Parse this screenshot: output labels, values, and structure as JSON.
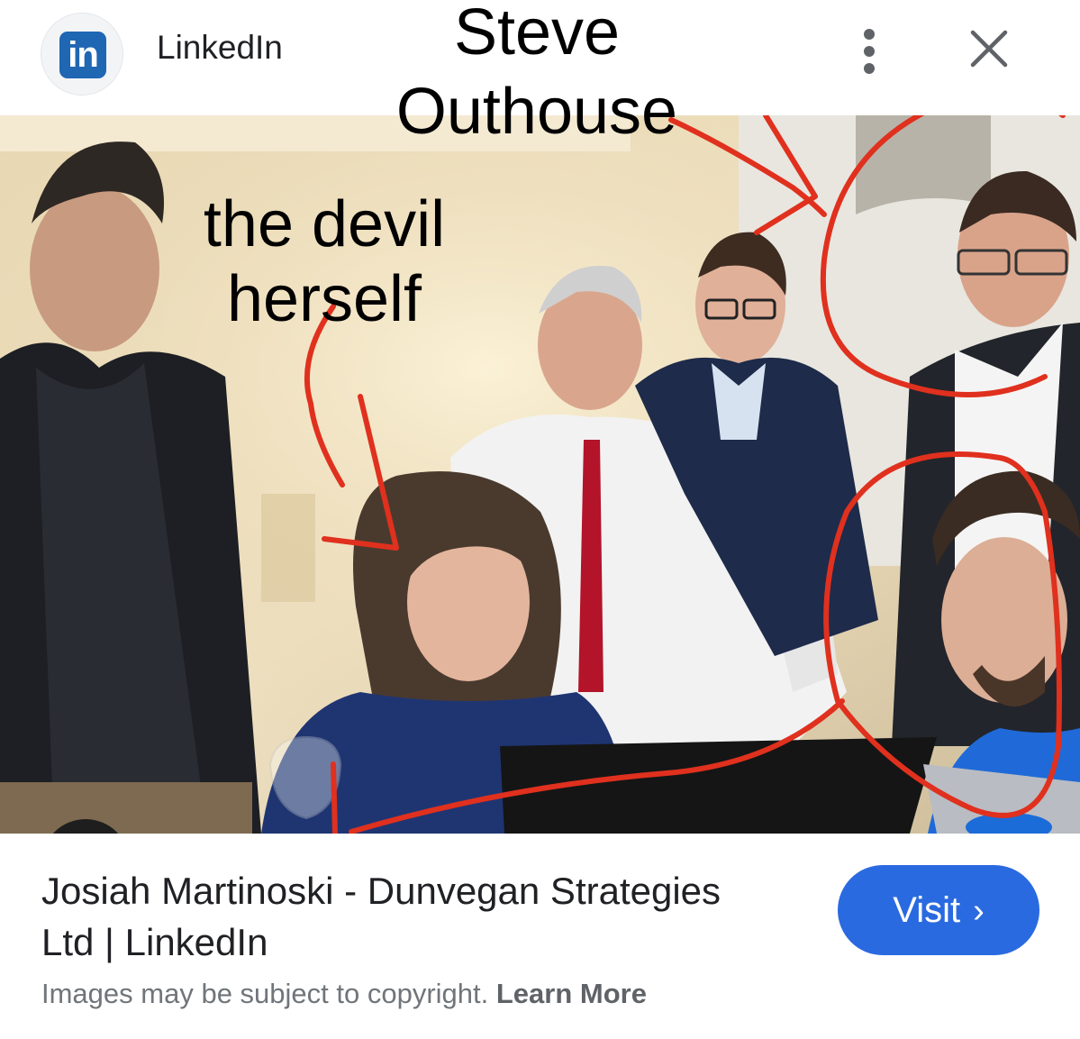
{
  "header": {
    "logo_text": "in",
    "site_name": "LinkedIn",
    "more_icon": "more-vertical-icon",
    "close_icon": "close-icon"
  },
  "annotations": {
    "name_line1": "Steve",
    "name_line2": "Outhouse",
    "devil_line1": "the devil",
    "devil_line2": "herself",
    "pen_color": "#e0301e"
  },
  "photo": {
    "lens_icon": "google-lens-icon"
  },
  "result": {
    "title": "Josiah Martinoski - Dunvegan Strategies Ltd | LinkedIn",
    "visit_label": "Visit",
    "copyright_text": "Images may be subject to copyright.",
    "learn_more": "Learn More"
  },
  "colors": {
    "accent": "#2a6ae0",
    "linkedin_blue": "#1f66b3"
  }
}
